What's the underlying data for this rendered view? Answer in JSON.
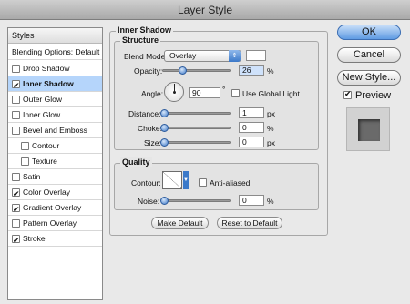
{
  "window": {
    "title": "Layer Style"
  },
  "styles_panel": {
    "header": "Styles",
    "blending_label": "Blending Options: Default",
    "items": [
      {
        "label": "Drop Shadow",
        "checked": false
      },
      {
        "label": "Inner Shadow",
        "checked": true,
        "selected": true
      },
      {
        "label": "Outer Glow",
        "checked": false
      },
      {
        "label": "Inner Glow",
        "checked": false
      },
      {
        "label": "Bevel and Emboss",
        "checked": false
      },
      {
        "label": "Contour",
        "checked": false,
        "indent": true
      },
      {
        "label": "Texture",
        "checked": false,
        "indent": true
      },
      {
        "label": "Satin",
        "checked": false
      },
      {
        "label": "Color Overlay",
        "checked": true
      },
      {
        "label": "Gradient Overlay",
        "checked": true
      },
      {
        "label": "Pattern Overlay",
        "checked": false
      },
      {
        "label": "Stroke",
        "checked": true
      }
    ]
  },
  "panel": {
    "title": "Inner Shadow",
    "structure": {
      "title": "Structure",
      "blend_mode_label": "Blend Mode:",
      "blend_mode_value": "Overlay",
      "opacity_label": "Opacity:",
      "opacity_value": "26",
      "opacity_pct": 0.26,
      "percent": "%",
      "angle_label": "Angle:",
      "angle_value": "90",
      "degree": "°",
      "global_light_label": "Use Global Light",
      "distance_label": "Distance:",
      "distance_value": "1",
      "choke_label": "Choke:",
      "choke_value": "0",
      "size_label": "Size:",
      "size_value": "0",
      "px": "px"
    },
    "quality": {
      "title": "Quality",
      "contour_label": "Contour:",
      "anti_aliased_label": "Anti-aliased",
      "noise_label": "Noise:",
      "noise_value": "0"
    },
    "make_default": "Make Default",
    "reset_default": "Reset to Default"
  },
  "actions": {
    "ok": "OK",
    "cancel": "Cancel",
    "new_style": "New Style...",
    "preview": "Preview"
  },
  "colors": {
    "accent": "#3b79c9",
    "selected_row": "#b5d5fb"
  }
}
